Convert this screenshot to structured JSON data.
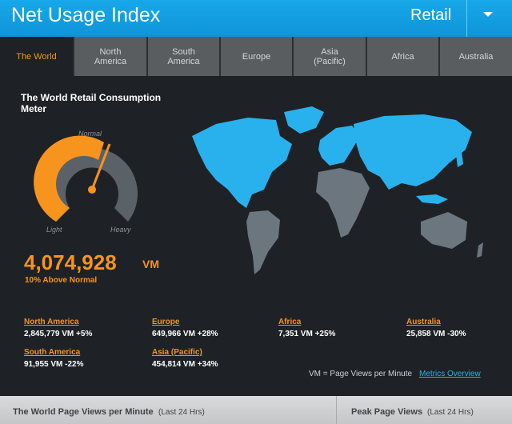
{
  "header": {
    "title": "Net Usage Index",
    "segment": "Retail"
  },
  "tabs": [
    {
      "label": "The World",
      "active": true
    },
    {
      "label": "North America"
    },
    {
      "label": "South America"
    },
    {
      "label": "Europe"
    },
    {
      "label": "Asia (Pacific)"
    },
    {
      "label": "Africa"
    },
    {
      "label": "Australia"
    }
  ],
  "meter": {
    "title": "The World Retail Consumption Meter",
    "label_normal": "Normal",
    "label_light": "Light",
    "label_heavy": "Heavy",
    "value": "4,074,928",
    "unit": "VM",
    "status": "10% Above Normal",
    "level_fraction": 0.6
  },
  "regions": [
    {
      "name": "North America",
      "value": "2,845,779 VM +5%"
    },
    {
      "name": "Europe",
      "value": "649,966 VM +28%"
    },
    {
      "name": "Africa",
      "value": "7,351 VM +25%"
    },
    {
      "name": "Australia",
      "value": "25,858 VM -30%"
    },
    {
      "name": "South America",
      "value": "91,955 VM -22%"
    },
    {
      "name": "Asia (Pacific)",
      "value": "454,814 VM +34%"
    }
  ],
  "legend": {
    "text": "VM = Page Views per Minute",
    "link": "Metrics Overview"
  },
  "footer": {
    "left_title": "The World Page Views per Minute",
    "left_sub": "(Last 24 Hrs)",
    "right_title": "Peak Page Views",
    "right_sub": "(Last 24 Hrs)"
  },
  "colors": {
    "accent": "#f7941d",
    "header_blue": "#17a8ea",
    "map_highlight": "#29b1ee",
    "map_dim": "#6b767f"
  }
}
